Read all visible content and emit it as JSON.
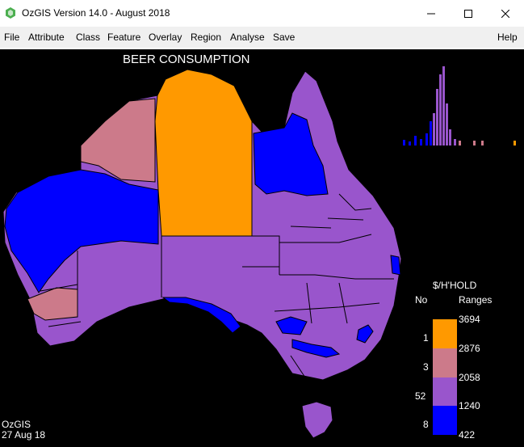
{
  "window": {
    "title": "OzGIS Version 14.0 - August 2018",
    "app_icon": "ozgis-app-icon",
    "controls": [
      "minimize-icon",
      "maximize-icon",
      "close-icon"
    ]
  },
  "menu": {
    "items": [
      "File",
      "Attribute",
      "Class",
      "Feature",
      "Overlay",
      "Region",
      "Analyse",
      "Save"
    ],
    "help": "Help"
  },
  "map": {
    "title": "BEER CONSUMPTION",
    "stamp_app": "OzGIS",
    "stamp_date": "27 Aug 18",
    "background": "#000000"
  },
  "legend": {
    "title": "$/H'HOLD",
    "col_no": "No",
    "col_ranges": "Ranges",
    "break_values": [
      "3694",
      "2876",
      "2058",
      "1240",
      "422"
    ],
    "classes": [
      {
        "count": "",
        "color": "#ff9900"
      },
      {
        "count": "1",
        "color": "#d98c8c"
      },
      {
        "count": "3",
        "color": "#9933cc"
      },
      {
        "count": "52",
        "color": "#0000ff"
      },
      {
        "count": "8",
        "color": "#0000ff"
      }
    ]
  },
  "colors": {
    "orange": "#ff9900",
    "pink": "#cc7a8a",
    "purple": "#9955cc",
    "blue": "#0000ff"
  }
}
